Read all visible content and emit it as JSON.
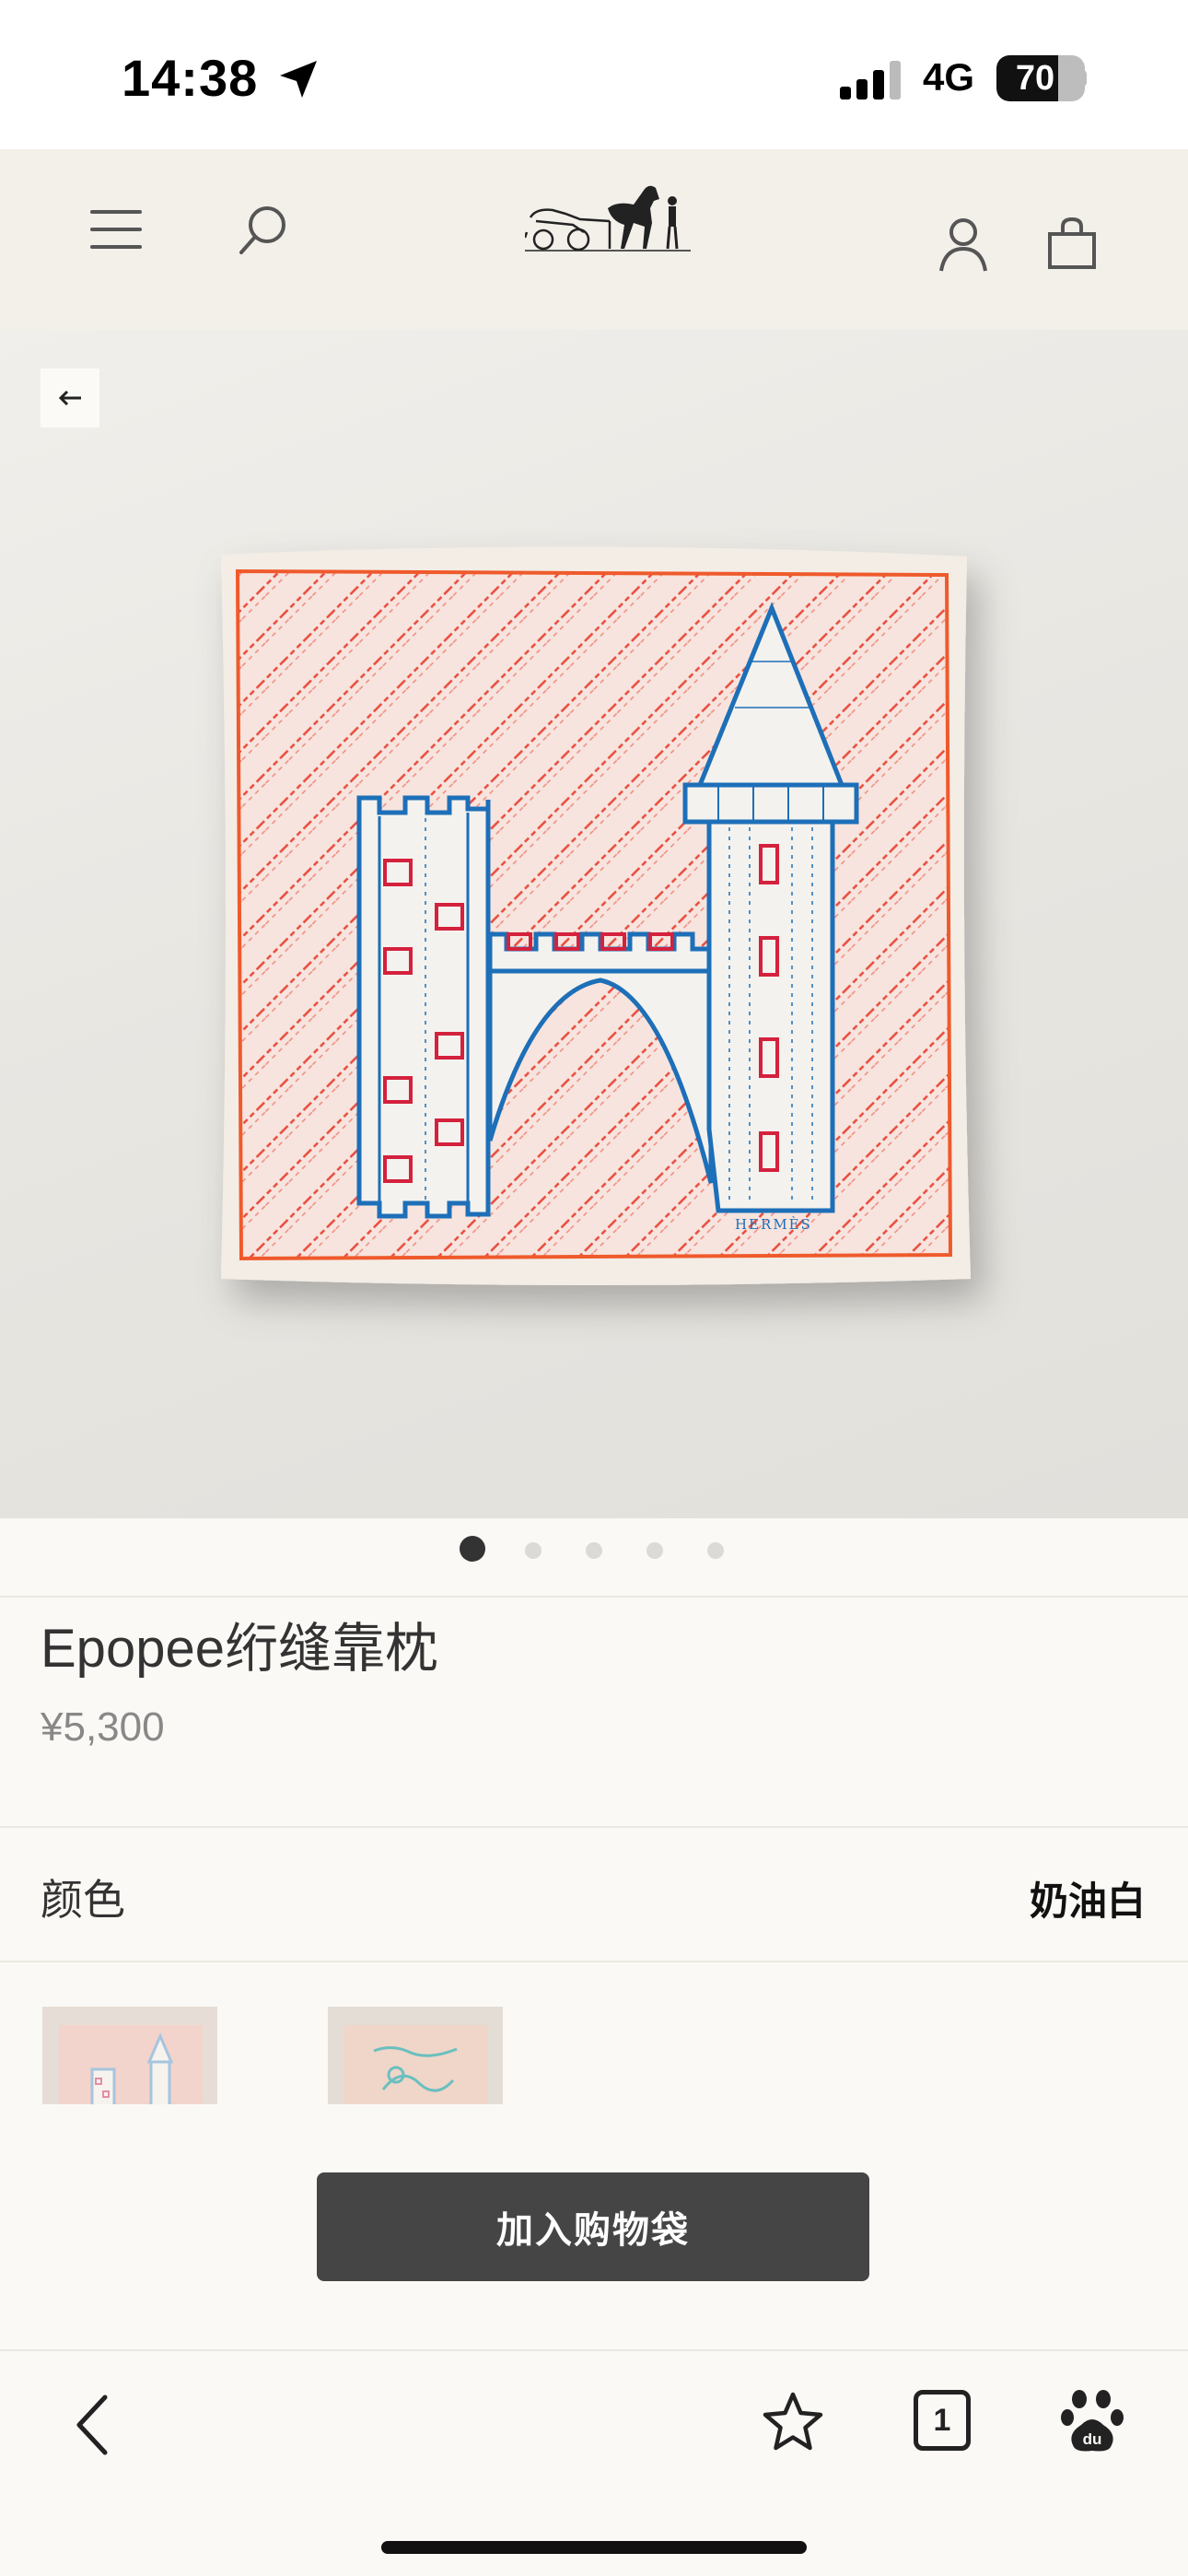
{
  "status_bar": {
    "time": "14:38",
    "network": "4G",
    "battery": "70",
    "battery_level": 0.7
  },
  "header": {
    "icons": [
      "menu-icon",
      "search-icon",
      "hermes-carriage-logo",
      "account-icon",
      "shopping-bag-icon"
    ]
  },
  "gallery": {
    "image_count": 5,
    "active_index": 0,
    "pillow_signature": "HERMÈS"
  },
  "product": {
    "title": "Epopee绗缝靠枕",
    "price": "¥5,300"
  },
  "color": {
    "label": "颜色",
    "value": "奶油白",
    "swatches": [
      {
        "name": "cream-white-swatch",
        "selected": true
      },
      {
        "name": "light-blue-swatch",
        "selected": false
      }
    ]
  },
  "cta": {
    "add_to_bag": "加入购物袋"
  },
  "browser": {
    "tab_count": "1",
    "icons": [
      "back-chevron-icon",
      "star-icon",
      "tabs-icon",
      "baidu-paw-icon"
    ]
  },
  "colors": {
    "header_bg": "#f3f0ea",
    "page_bg": "#fbf9f5",
    "button_bg": "#454545",
    "stitch_red": "#e94b3c",
    "embroidery_blue": "#1d6fb8"
  }
}
